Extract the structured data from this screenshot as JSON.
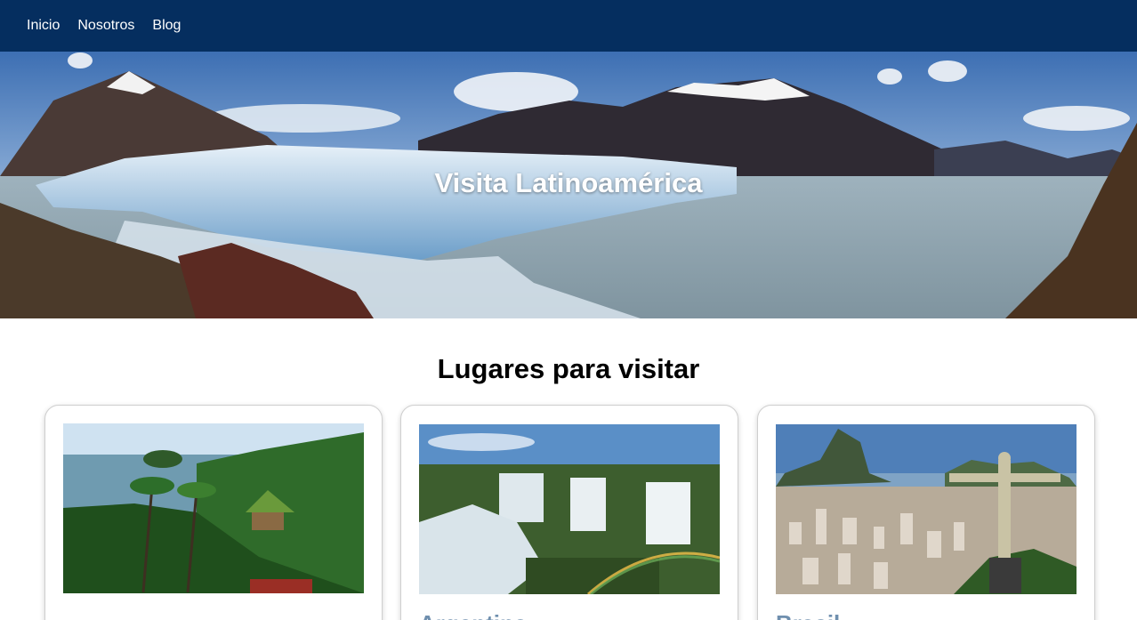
{
  "nav": {
    "items": [
      {
        "label": "Inicio"
      },
      {
        "label": "Nosotros"
      },
      {
        "label": "Blog"
      }
    ]
  },
  "hero": {
    "title": "Visita Latinoamérica"
  },
  "places": {
    "heading": "Lugares para visitar",
    "cards": [
      {
        "title": ""
      },
      {
        "title": "Argentina"
      },
      {
        "title": "Brasil"
      }
    ]
  },
  "colors": {
    "nav_background": "#052e5f",
    "card_title": "#6f8fae"
  }
}
